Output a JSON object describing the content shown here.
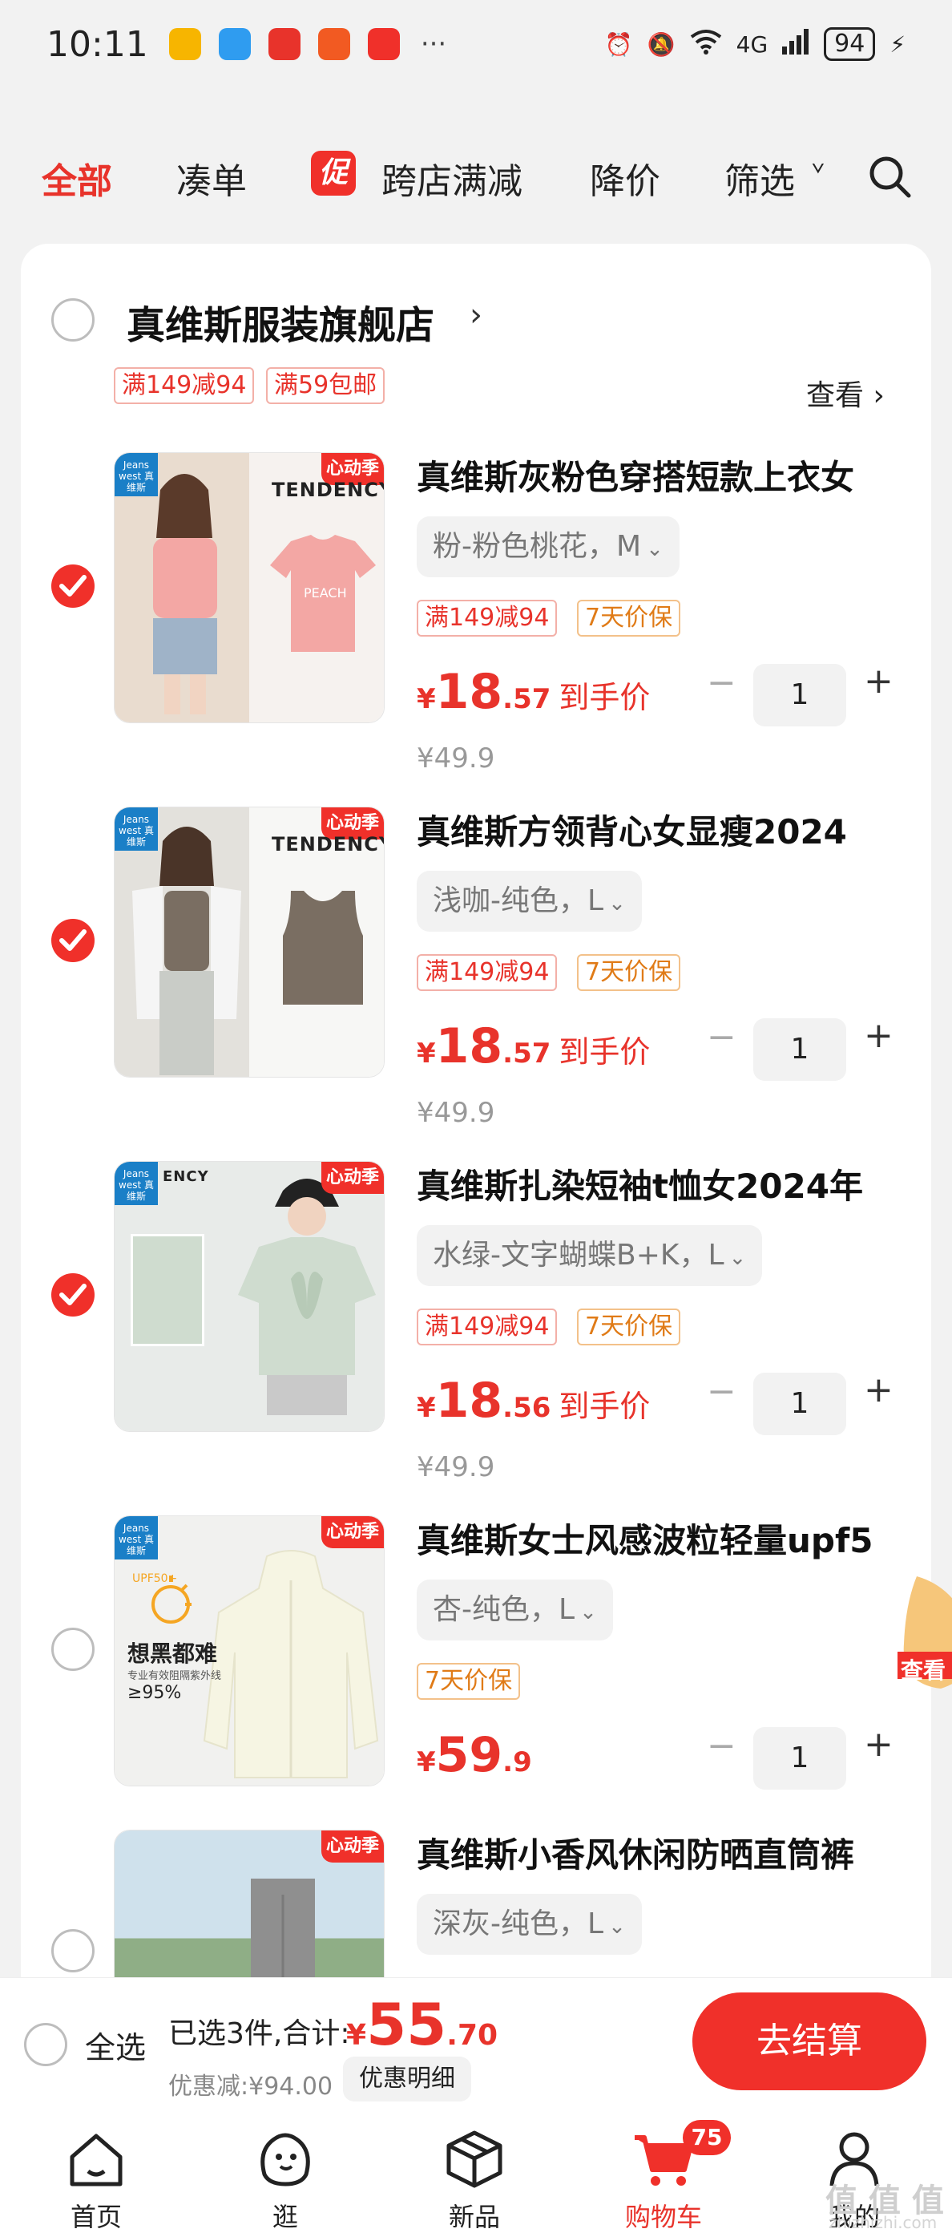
{
  "status_bar": {
    "time": "10:11",
    "network": "4G",
    "battery": "94",
    "dots": "···",
    "app_icon_colors": [
      "#f7b500",
      "#2f9cf0",
      "#e8332b",
      "#f25a22",
      "#f0302a"
    ]
  },
  "filter_tabs": [
    {
      "label": "全部",
      "active": true
    },
    {
      "label": "凑单"
    },
    {
      "label": "跨店满减",
      "badge": "促"
    },
    {
      "label": "降价"
    },
    {
      "label": "筛选"
    }
  ],
  "filter_more": "ᘁ",
  "shop": {
    "name": "真维斯服装旗舰店",
    "arrow": "›",
    "tags": [
      "满149减94",
      "满59包邮"
    ],
    "view_link": "查看 ›"
  },
  "items": [
    {
      "checked": true,
      "title": "真维斯灰粉色穿搭短款上衣女",
      "sku": "粉-粉色桃花，M",
      "tags": [
        "满149减94",
        "7天价保"
      ],
      "price_yen": "¥",
      "price_int": "18",
      "price_dec": ".57",
      "price_note": "到手价",
      "original_price": "¥49.9",
      "quantity": "1",
      "brand_text": "Jeans west 真维斯",
      "campaign_badge": "心动季",
      "banner_text": "TENDENCY"
    },
    {
      "checked": true,
      "title": "真维斯方领背心女显瘦2024",
      "sku": "浅咖-纯色，L",
      "tags": [
        "满149减94",
        "7天价保"
      ],
      "price_yen": "¥",
      "price_int": "18",
      "price_dec": ".57",
      "price_note": "到手价",
      "original_price": "¥49.9",
      "quantity": "1",
      "brand_text": "Jeans west 真维斯",
      "campaign_badge": "心动季",
      "banner_text": "TENDENCY"
    },
    {
      "checked": true,
      "title": "真维斯扎染短袖t恤女2024年",
      "sku": "水绿-文字蝴蝶B+K，L",
      "tags": [
        "满149减94",
        "7天价保"
      ],
      "price_yen": "¥",
      "price_int": "18",
      "price_dec": ".56",
      "price_note": "到手价",
      "original_price": "¥49.9",
      "quantity": "1",
      "brand_text": "Jeans west 真维斯",
      "campaign_badge": "心动季",
      "banner_text": "ENCY"
    },
    {
      "checked": false,
      "title": "真维斯女士风感波粒轻量upf5",
      "sku": "杏-纯色，L",
      "tags": [
        "7天价保"
      ],
      "price_yen": "¥",
      "price_int": "59",
      "price_dec": ".9",
      "price_note": "",
      "original_price": "",
      "quantity": "1",
      "brand_text": "Jeans west 真维斯",
      "campaign_badge": "心动季",
      "promo_title": "想黑都难",
      "promo_sub": "专业有效阻隔紫外线",
      "promo_pct": "≥95%",
      "promo_upf": "UPF50+"
    },
    {
      "checked": false,
      "title": "真维斯小香风休闲防晒直筒裤",
      "sku": "深灰-纯色，L",
      "brand_text": "",
      "campaign_badge": "心动季"
    }
  ],
  "float_badge": "查看",
  "checkout": {
    "select_all": "全选",
    "selected_summary": "已选3件,合计:",
    "total_yen": "¥",
    "total_int": "55",
    "total_dec": ".70",
    "discount": "优惠减:¥94.00",
    "discount_detail": "优惠明细",
    "button": "去结算"
  },
  "nav": [
    {
      "label": "首页",
      "icon": "home-icon"
    },
    {
      "label": "逛",
      "icon": "stroll-icon"
    },
    {
      "label": "新品",
      "icon": "new-icon"
    },
    {
      "label": "购物车",
      "icon": "cart-icon",
      "active": true,
      "badge": "75"
    },
    {
      "label": "我的",
      "icon": "profile-icon"
    }
  ],
  "watermark": "值 值 值",
  "watermark_sub": "zhizhizhi.com",
  "colors": {
    "accent": "#f0302a",
    "tag_orange": "#e07b17",
    "price": "#e8332b"
  }
}
